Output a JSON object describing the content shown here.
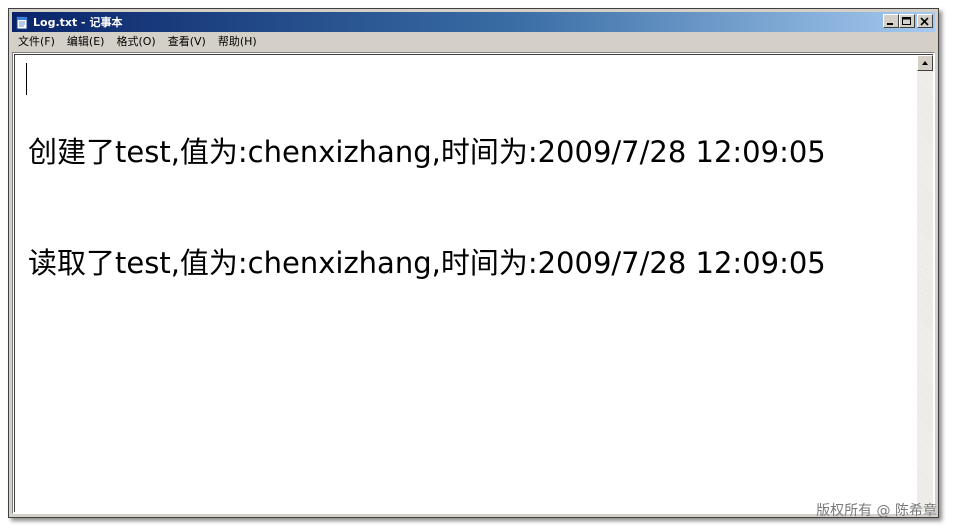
{
  "window": {
    "title": "Log.txt - 记事本"
  },
  "menu": {
    "items": [
      {
        "label": "文件(F)"
      },
      {
        "label": "编辑(E)"
      },
      {
        "label": "格式(O)"
      },
      {
        "label": "查看(V)"
      },
      {
        "label": "帮助(H)"
      }
    ]
  },
  "editor": {
    "lines": [
      "创建了test,值为:chenxizhang,时间为:2009/7/28 12:09:05",
      "读取了test,值为:chenxizhang,时间为:2009/7/28 12:09:05"
    ]
  },
  "watermark": {
    "text": "版权所有 @ 陈希章"
  },
  "colors": {
    "titlebar_start": "#0a246a",
    "titlebar_end": "#a6caf0",
    "window_face": "#d4d0c8"
  },
  "icons": {
    "app": "notepad-icon",
    "minimize": "minimize-icon",
    "maximize": "maximize-icon",
    "close": "close-icon",
    "scroll_up": "scroll-up-arrow-icon"
  }
}
